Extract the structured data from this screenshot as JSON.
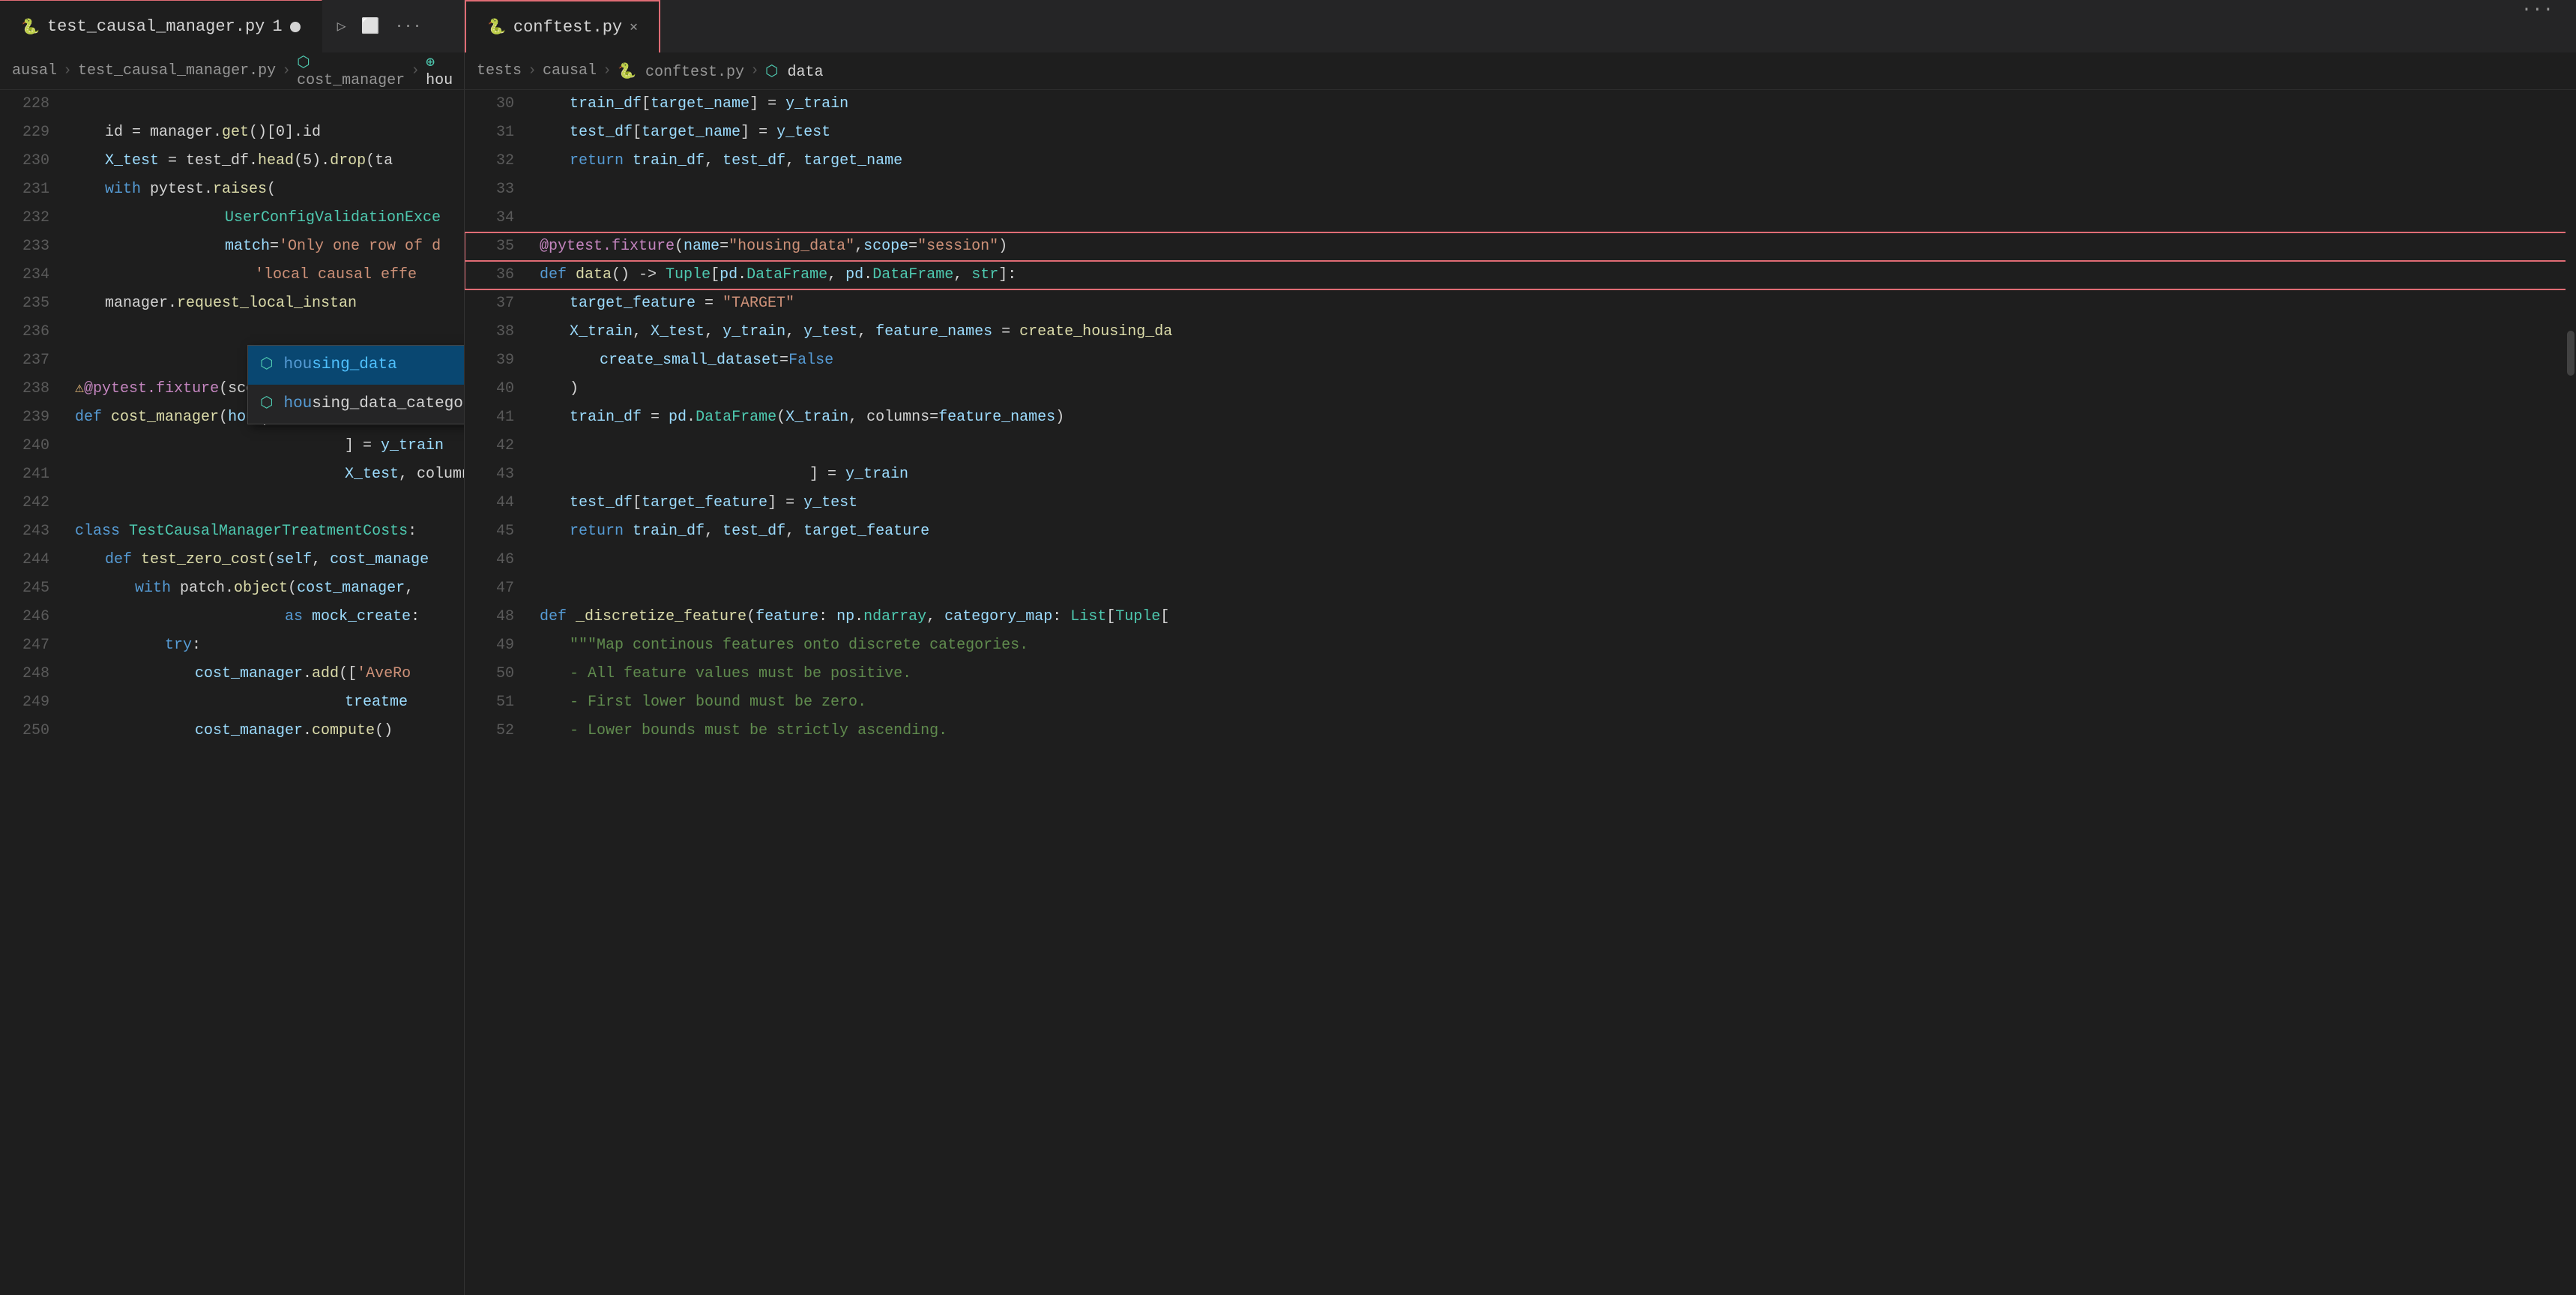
{
  "tabs": {
    "left": {
      "label": "test_causal_manager.py",
      "modified": true,
      "number": "1",
      "icon": "🐍"
    },
    "left_actions": [
      "▷",
      "⬜",
      "···"
    ],
    "right": {
      "label": "conftest.py",
      "active": true,
      "icon": "🐍"
    },
    "more": "···"
  },
  "breadcrumbs": {
    "left": [
      "ausal",
      "test_causal_manager.py",
      "cost_manager",
      "hou"
    ],
    "right": [
      "tests",
      "causal",
      "conftest.py",
      "data"
    ]
  },
  "left_code": [
    {
      "num": "228",
      "content": ""
    },
    {
      "num": "229",
      "content": "    id = manager.get()[0].id"
    },
    {
      "num": "230",
      "content": "    X_test = test_df.head(5).drop(ta"
    },
    {
      "num": "231",
      "content": "    with pytest.raises("
    },
    {
      "num": "232",
      "content": "            UserConfigValidationExce"
    },
    {
      "num": "233",
      "content": "            match='Only one row of d"
    },
    {
      "num": "234",
      "content": "            'local causal effe"
    },
    {
      "num": "235",
      "content": "    manager.request_local_instan"
    },
    {
      "num": "236",
      "content": ""
    },
    {
      "num": "237",
      "content": ""
    },
    {
      "num": "238",
      "content": "@pytest.fixture(scope='class')"
    },
    {
      "num": "239",
      "content": "def cost_manager(hou)"
    },
    {
      "num": "240",
      "content": "                            ] = y_train"
    },
    {
      "num": "241",
      "content": "                            X_test, columns=feature_names)"
    },
    {
      "num": "242",
      "content": ""
    },
    {
      "num": "243",
      "content": "class TestCausalManagerTreatmentCosts:"
    },
    {
      "num": "244",
      "content": "    def test_zero_cost(self, cost_manage"
    },
    {
      "num": "245",
      "content": "        with patch.object(cost_manager,"
    },
    {
      "num": "246",
      "content": "                as mock_create:"
    },
    {
      "num": "247",
      "content": "            try:"
    },
    {
      "num": "248",
      "content": "                cost_manager.add(['AveRo"
    },
    {
      "num": "249",
      "content": "                            treatme"
    },
    {
      "num": "250",
      "content": "                cost_manager.compute()"
    }
  ],
  "right_code": [
    {
      "num": "30",
      "content": "    train_df[target_name] = y_train"
    },
    {
      "num": "31",
      "content": "    test_df[target_name] = y_test"
    },
    {
      "num": "32",
      "content": "    return train_df, test_df, target_name"
    },
    {
      "num": "33",
      "content": ""
    },
    {
      "num": "34",
      "content": ""
    },
    {
      "num": "35",
      "content": "@pytest.fixture(name=\"housing_data\",scope=\"session\")"
    },
    {
      "num": "36",
      "content": "def data() -> Tuple[pd.DataFrame, pd.DataFrame, str]:"
    },
    {
      "num": "37",
      "content": "    target_feature = \"TARGET\""
    },
    {
      "num": "38",
      "content": "    X_train, X_test, y_train, y_test, feature_names = create_housing_da"
    },
    {
      "num": "39",
      "content": "        create_small_dataset=False"
    },
    {
      "num": "40",
      "content": "    )"
    },
    {
      "num": "41",
      "content": "    train_df = pd.DataFrame(X_train, columns=feature_names)"
    },
    {
      "num": "42",
      "content": ""
    },
    {
      "num": "43",
      "content": "                            ] = y_train"
    },
    {
      "num": "44",
      "content": "    test_df[target_feature] = y_test"
    },
    {
      "num": "45",
      "content": "    return train_df, test_df, target_feature"
    },
    {
      "num": "46",
      "content": ""
    },
    {
      "num": "47",
      "content": ""
    },
    {
      "num": "48",
      "content": "def _discretize_feature(feature: np.ndarray, category_map: List[Tuple["
    },
    {
      "num": "49",
      "content": "    \"\"\"Map continous features onto discrete categories."
    },
    {
      "num": "50",
      "content": "    - All feature values must be positive."
    },
    {
      "num": "51",
      "content": "    - First lower bound must be zero."
    },
    {
      "num": "52",
      "content": "    - Lower bounds must be strictly ascending."
    }
  ],
  "autocomplete": {
    "items": [
      {
        "icon": "⬡",
        "text": "housing_data",
        "prefix": "hou",
        "suffix": "sing_data"
      },
      {
        "icon": "⬡",
        "text": "housing_data_categorical",
        "prefix": "hou",
        "suffix": "sing_data_categorical"
      }
    ]
  },
  "colors": {
    "accent": "#e06c75",
    "keyword": "#569cd6",
    "function": "#dcdcaa",
    "string": "#ce9178",
    "comment": "#608b4e",
    "decorator": "#c586c0",
    "class_color": "#4ec9b0",
    "variable": "#9cdcfe",
    "number": "#b5cea8",
    "boolean": "#569cd6"
  }
}
